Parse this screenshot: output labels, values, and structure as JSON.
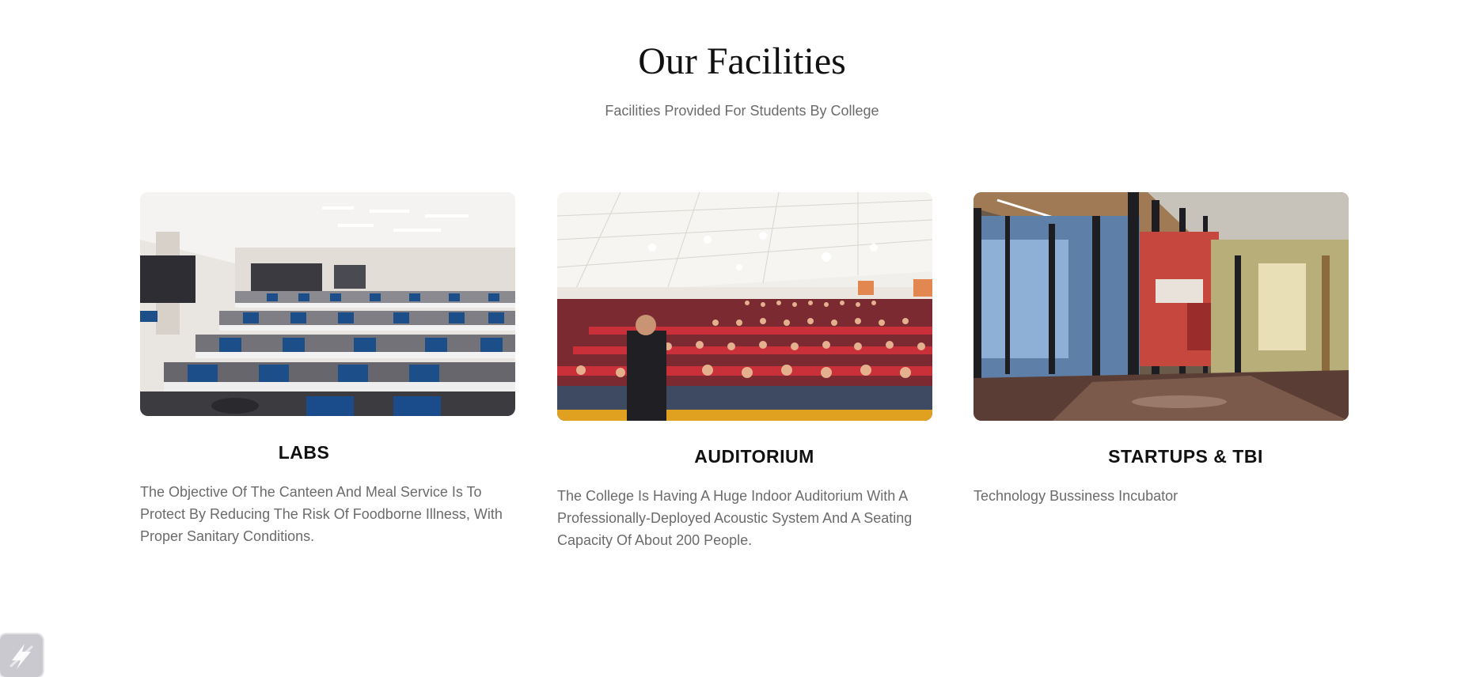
{
  "header": {
    "title": "Our Facilities",
    "subtitle": "Facilities Provided For Students By College"
  },
  "facilities": [
    {
      "title": "LABS",
      "description": "The Objective Of The Canteen And Meal Service Is To Protect By Reducing The Risk Of Foodborne Illness, With Proper Sanitary Conditions.",
      "image": "computer-lab-photo"
    },
    {
      "title": "AUDITORIUM",
      "description": "The College Is Having A Huge Indoor Auditorium With A Professionally-Deployed Acoustic System And A Seating Capacity Of About 200 People.",
      "image": "auditorium-photo"
    },
    {
      "title": "STARTUPS & TBI",
      "description": "Technology Bussiness Incubator",
      "image": "incubator-hallway-photo"
    }
  ],
  "widget": {
    "icon": "lightning-bolt-icon"
  }
}
